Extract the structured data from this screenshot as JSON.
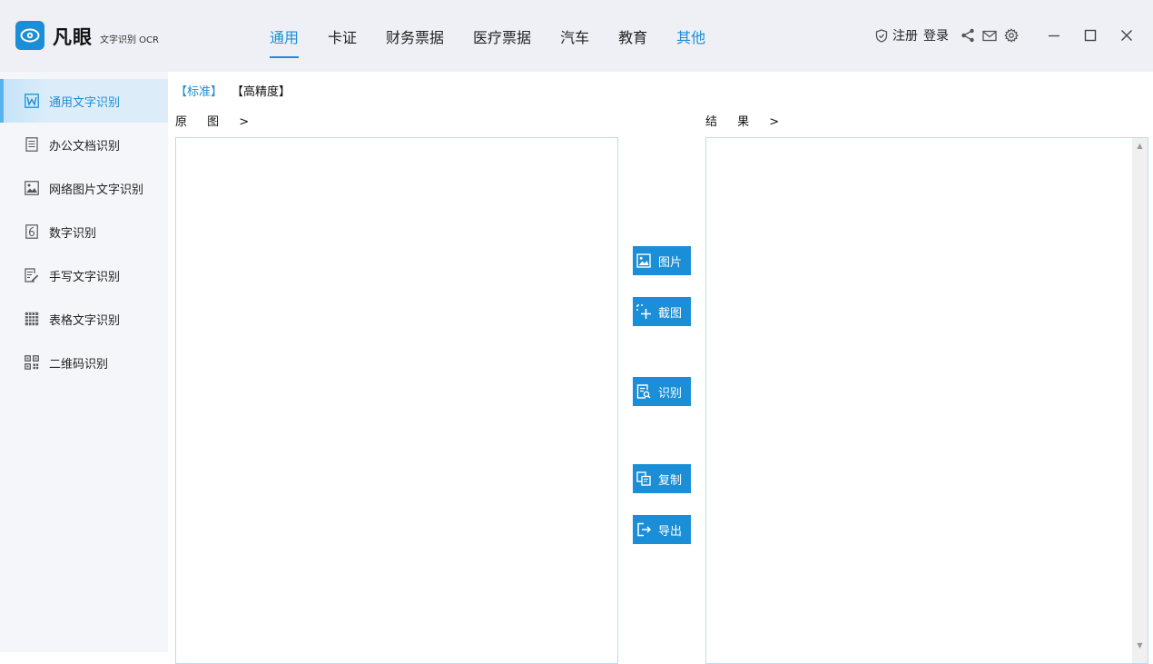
{
  "app": {
    "name": "凡眼",
    "subtitle": "文字识别 OCR"
  },
  "nav": {
    "tabs": [
      {
        "label": "通用",
        "state": "active"
      },
      {
        "label": "卡证"
      },
      {
        "label": "财务票据"
      },
      {
        "label": "医疗票据"
      },
      {
        "label": "汽车"
      },
      {
        "label": "教育"
      },
      {
        "label": "其他",
        "state": "accent"
      }
    ]
  },
  "header_right": {
    "register_label": "注册",
    "login_label": "登录",
    "icons": [
      "shield-icon",
      "share-icon",
      "mail-icon",
      "settings-icon"
    ]
  },
  "window_controls": [
    "minimize-icon",
    "maximize-icon",
    "close-icon"
  ],
  "sidebar": {
    "items": [
      {
        "label": "通用文字识别",
        "icon": "word-icon",
        "active": true
      },
      {
        "label": "办公文档识别",
        "icon": "document-icon"
      },
      {
        "label": "网络图片文字识别",
        "icon": "image-icon"
      },
      {
        "label": "数字识别",
        "icon": "number-icon"
      },
      {
        "label": "手写文字识别",
        "icon": "handwriting-icon"
      },
      {
        "label": "表格文字识别",
        "icon": "table-icon"
      },
      {
        "label": "二维码识别",
        "icon": "qrcode-icon"
      }
    ]
  },
  "modes": {
    "standard": "【标准】",
    "high_precision": "【高精度】"
  },
  "panes": {
    "source_label": "原 图 >",
    "result_label": "结 果 >"
  },
  "actions": {
    "image": "图片",
    "screenshot": "截图",
    "recognize": "识别",
    "copy": "复制",
    "export": "导出"
  },
  "colors": {
    "accent": "#1a8ed6",
    "header_bg": "#eff0f5",
    "sidebar_bg": "#f5f6fa",
    "active_item_bg": "#dcedf9",
    "pane_border": "#b9ddf2"
  }
}
